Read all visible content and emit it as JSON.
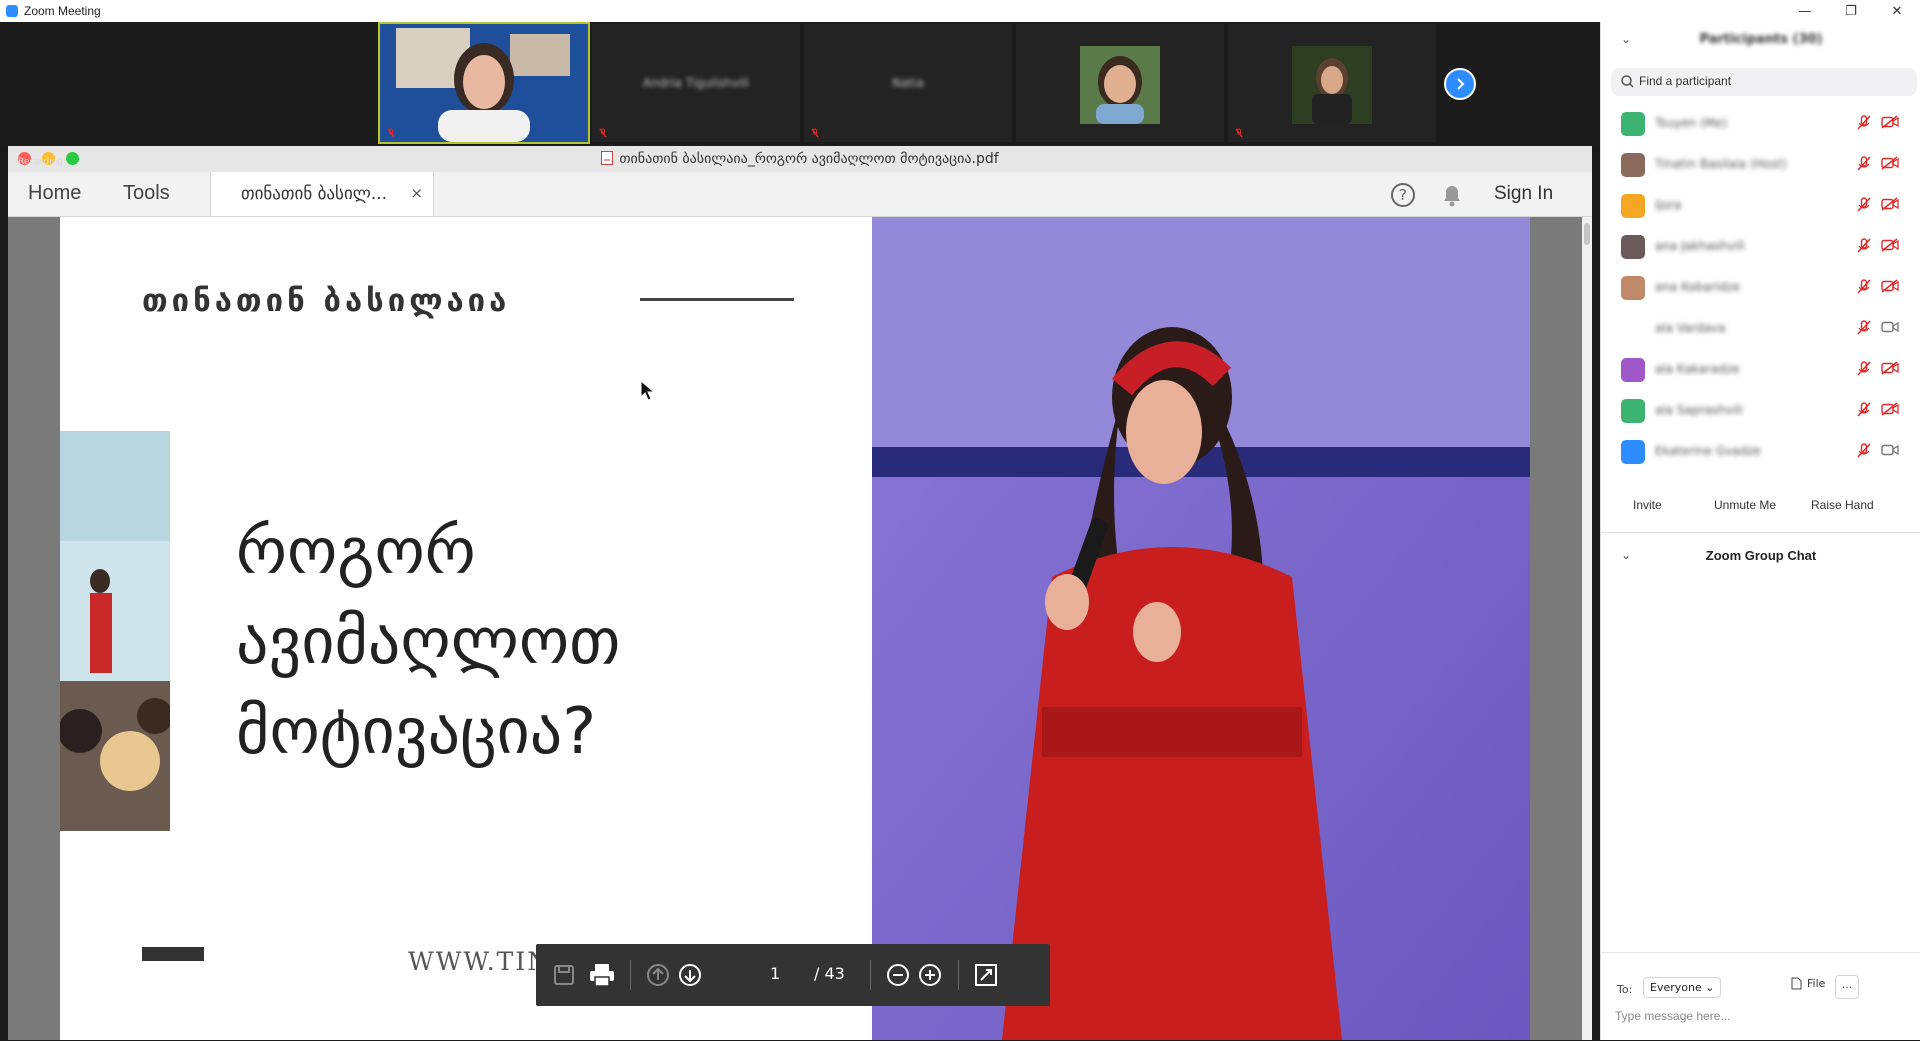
{
  "window": {
    "title": "Zoom Meeting",
    "controls": [
      "—",
      "❐",
      "✕"
    ]
  },
  "video_strip": {
    "tiles": [
      {
        "name": "",
        "active": true
      },
      {
        "name": "Andria Tigulishvili"
      },
      {
        "name": "Natia"
      },
      {
        "name": ""
      },
      {
        "name": ""
      }
    ]
  },
  "pdf": {
    "title": "თინათინ ბასილაია_როგორ ავიმაღლოთ მოტივაცია.pdf",
    "recording_badge": "Recording",
    "nav": {
      "home": "Home",
      "tools": "Tools"
    },
    "tab_label": "თინათინ ბასილ...",
    "tab_close": "×",
    "sign_in": "Sign In",
    "page_current": "1",
    "page_total": "/ 43",
    "slide": {
      "author": "თინათინ ბასილაია",
      "title_line1": "როგორ",
      "title_line2": "ავიმაღლოთ",
      "title_line3": "მოტივაცია?",
      "website": "WWW.TINATINBASILAIA.COM"
    }
  },
  "participants": {
    "title": "Participants (30)",
    "search_placeholder": "Find a participant",
    "list": [
      {
        "name": "Tsuyen (Me)",
        "avatar_color": "#3cb371"
      },
      {
        "name": "Tinatin Basilaia (Host)",
        "avatar_color": "#8a6a5a"
      },
      {
        "name": "Ijora",
        "avatar_color": "#f5a623"
      },
      {
        "name": "ana Jakhashvili",
        "avatar_color": "#6a5a5a"
      },
      {
        "name": "ana Kobaridze",
        "avatar_color": "#c08a6a"
      },
      {
        "name": "ala Vardava",
        "avatar_color": "#ffffff"
      },
      {
        "name": "ala Kakaradze",
        "avatar_color": "#a058c8"
      },
      {
        "name": "ala Saprashvili",
        "avatar_color": "#3cb371"
      },
      {
        "name": "Ekaterine Gvadze",
        "avatar_color": "#2D8CFF"
      }
    ],
    "actions": {
      "invite": "Invite",
      "unmute": "Unmute Me",
      "raise_hand": "Raise Hand"
    }
  },
  "chat": {
    "title": "Zoom Group Chat",
    "to_label": "To:",
    "to_value": "Everyone",
    "file_label": "File",
    "more_label": "···",
    "input_placeholder": "Type message here..."
  },
  "colors": {
    "zoom_blue": "#2D8CFF",
    "dark_bg": "#1a1a1a",
    "red_icon": "#e02828"
  }
}
